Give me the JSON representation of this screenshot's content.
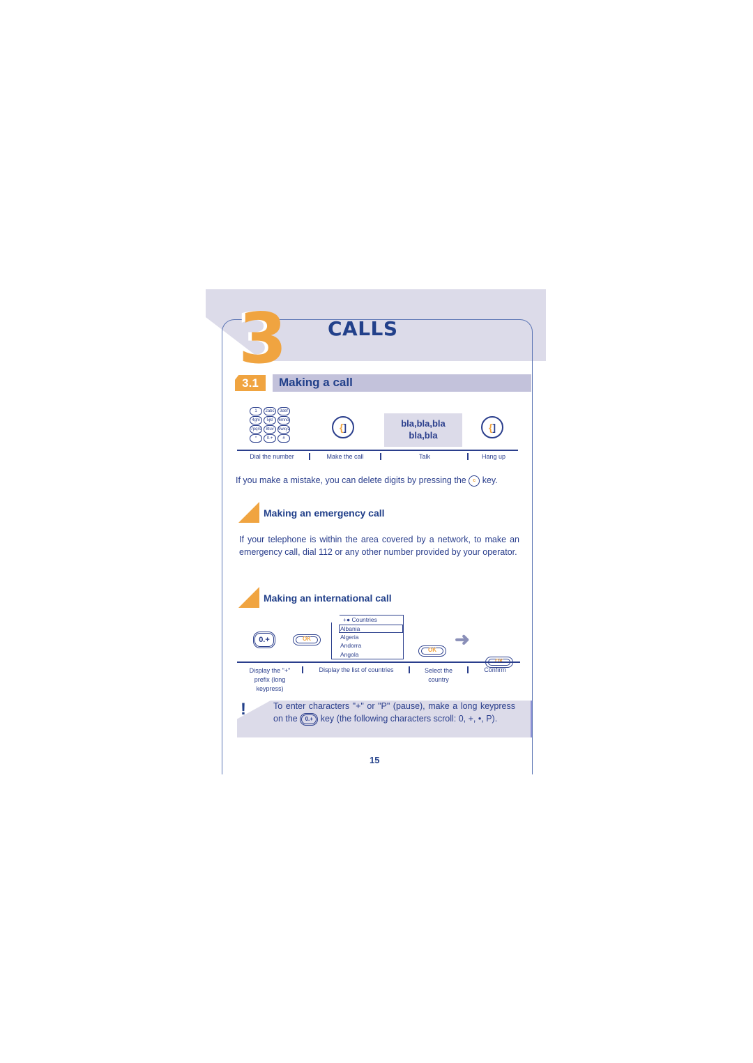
{
  "chapter": {
    "number": "3",
    "title": "CALLS"
  },
  "section": {
    "number": "3.1",
    "title": "Making a call"
  },
  "call_steps": {
    "keypad_keys": [
      "1",
      "2abc",
      "3def",
      "4ghi",
      "5jkl",
      "6mno",
      "7pqrs",
      "8tuv",
      "9wxyz",
      "*",
      "0.+",
      "#"
    ],
    "talk_line1": "bla,bla,bla",
    "talk_line2": "bla,bla",
    "captions": [
      "Dial the number",
      "Make the call",
      "Talk",
      "Hang up"
    ]
  },
  "mistake_text": "If you make a mistake, you can delete digits by pressing the",
  "mistake_key": "c",
  "mistake_suffix": "key.",
  "emergency": {
    "title": "Making an emergency call",
    "text": "If your telephone is within the area covered by a network, to make an emergency call, dial 112 or any other number provided by your operator."
  },
  "international": {
    "title": "Making an international call",
    "zero_key": "0.+",
    "ok_label": "OK",
    "countries_header": "Countries",
    "countries": [
      "Albania",
      "Algeria",
      "Andorra",
      "Angola"
    ],
    "selected_country": "Albania",
    "captions": [
      "Display the \"+\" prefix (long keypress)",
      "Display the list of countries",
      "Select the country",
      "Confirm"
    ]
  },
  "note": {
    "part1": "To enter characters \"+\" or \"P\" (pause), make a long keypress on the",
    "key": "0.+",
    "part2": "key (the following characters scroll: 0, +, •, P)."
  },
  "page_number": "15"
}
